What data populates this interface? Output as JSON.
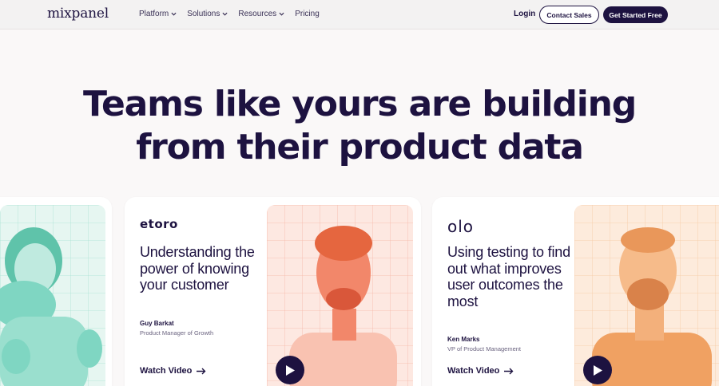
{
  "nav": {
    "logo": "mixpanel",
    "links": [
      {
        "label": "Platform",
        "dropdown": true
      },
      {
        "label": "Solutions",
        "dropdown": true
      },
      {
        "label": "Resources",
        "dropdown": true
      },
      {
        "label": "Pricing",
        "dropdown": false
      }
    ],
    "login": "Login",
    "contact": "Contact Sales",
    "cta": "Get Started Free"
  },
  "hero": {
    "line1": "Teams like yours are building",
    "line2": "from their product data"
  },
  "cards": [
    {
      "company": "etoro",
      "title": "Understanding the power of knowing your customer",
      "name": "Guy Barkat",
      "role": "Product Manager of Growth",
      "watch": "Watch Video",
      "photo_tint": "#f2876a"
    },
    {
      "company": "olo",
      "title": "Using testing to find out what improves user outcomes the most",
      "name": "Ken Marks",
      "role": "VP of Product Management",
      "watch": "Watch Video",
      "photo_tint": "#f0a162"
    }
  ],
  "colors": {
    "brand": "#1d1240",
    "teal_tint": "#7fd6c2",
    "background": "#faf8f8"
  }
}
